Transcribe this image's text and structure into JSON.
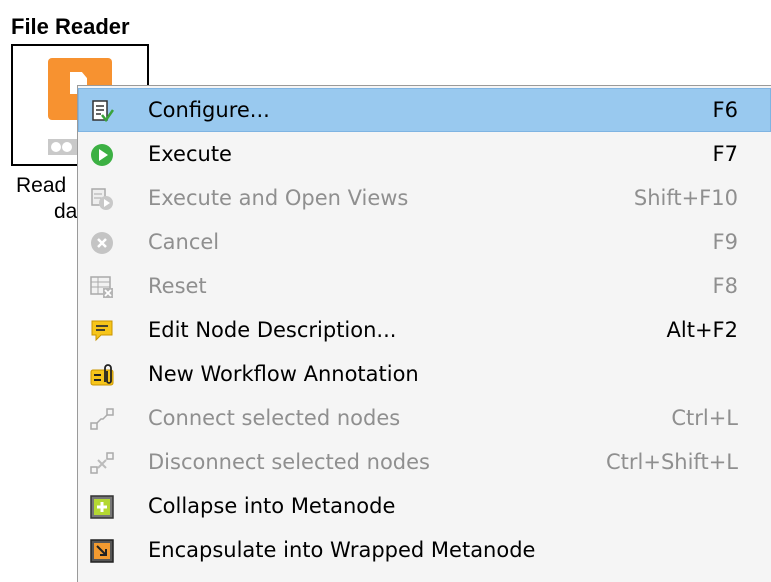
{
  "node": {
    "title": "File Reader",
    "label_lines": [
      "Read",
      "da"
    ]
  },
  "menu": {
    "items": [
      {
        "label": "Configure...",
        "shortcut": "F6",
        "icon": "configure-icon",
        "enabled": true,
        "highlighted": true
      },
      {
        "label": "Execute",
        "shortcut": "F7",
        "icon": "execute-icon",
        "enabled": true
      },
      {
        "label": "Execute and Open Views",
        "shortcut": "Shift+F10",
        "icon": "execute-open-views-icon",
        "enabled": false
      },
      {
        "label": "Cancel",
        "shortcut": "F9",
        "icon": "cancel-icon",
        "enabled": false
      },
      {
        "label": "Reset",
        "shortcut": "F8",
        "icon": "reset-icon",
        "enabled": false
      },
      {
        "label": "Edit Node Description...",
        "shortcut": "Alt+F2",
        "icon": "edit-description-icon",
        "enabled": true
      },
      {
        "label": "New Workflow Annotation",
        "shortcut": "",
        "icon": "annotation-icon",
        "enabled": true
      },
      {
        "label": "Connect selected nodes",
        "shortcut": "Ctrl+L",
        "icon": "connect-nodes-icon",
        "enabled": false
      },
      {
        "label": "Disconnect selected nodes",
        "shortcut": "Ctrl+Shift+L",
        "icon": "disconnect-nodes-icon",
        "enabled": false
      },
      {
        "label": "Collapse into Metanode",
        "shortcut": "",
        "icon": "collapse-metanode-icon",
        "enabled": true
      },
      {
        "label": "Encapsulate into Wrapped Metanode",
        "shortcut": "",
        "icon": "encapsulate-wrapped-metanode-icon",
        "enabled": true
      }
    ]
  },
  "colors": {
    "node_orange": "#f79230",
    "highlight": "#99c9ef",
    "menu_background": "#f5f5f5",
    "disabled_text": "#8f8f8f"
  }
}
